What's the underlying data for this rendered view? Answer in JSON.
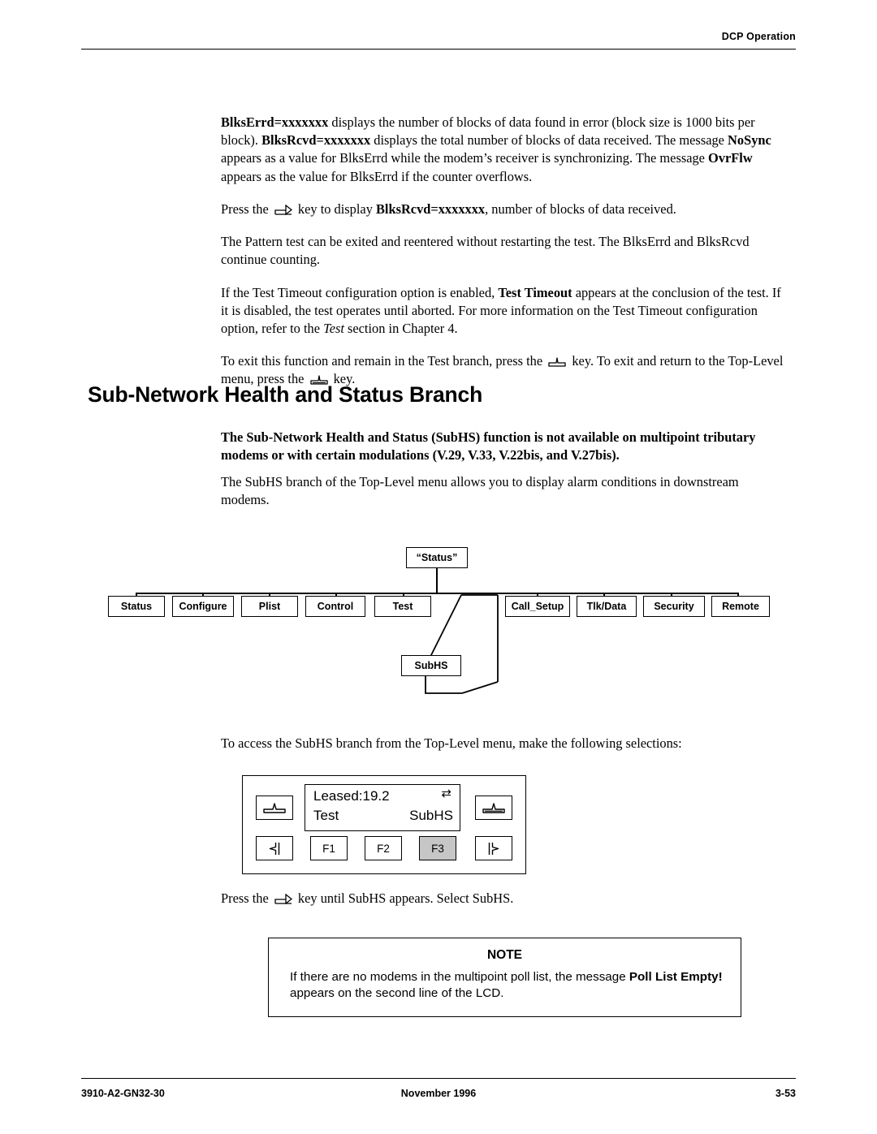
{
  "header": {
    "title": "DCP Operation"
  },
  "footer": {
    "left": "3910-A2-GN32-30",
    "center": "November 1996",
    "right": "3-53"
  },
  "paragraphs": {
    "p1_a": "BlksErrd=xxxxxxx",
    "p1_b": " displays the number of blocks of data found in error (block size is 1000 bits per block). ",
    "p1_c": "BlksRcvd=xxxxxxx",
    "p1_d": " displays the total number of blocks of data received. The message ",
    "p1_e": "NoSync",
    "p1_f": " appears as a value for BlksErrd while the modem’s receiver is synchronizing. The message ",
    "p1_g": "OvrFlw",
    "p1_h": " appears as the value for BlksErrd if the counter overflows.",
    "p2_a": "Press the ",
    "p2_b": " key to display ",
    "p2_c": "BlksRcvd=xxxxxxx",
    "p2_d": ", number of blocks of data received.",
    "p3": "The Pattern test can be exited and reentered without restarting the test. The BlksErrd and BlksRcvd continue counting.",
    "p4_a": "If the Test Timeout configuration option is enabled, ",
    "p4_b": "Test Timeout",
    "p4_c": " appears at the conclusion of the test. If it is disabled, the test operates until aborted. For more information on the Test Timeout configuration option, refer to the ",
    "p4_d": "Test",
    "p4_e": " section in Chapter 4.",
    "p5_a": "To exit this function and remain in the Test branch, press the ",
    "p5_b": " key. To exit and return to the Top-Level menu, press the ",
    "p5_c": " key.",
    "p6": "To access the SubHS branch from the Top-Level menu, make the following selections:",
    "p7_a": "Press the ",
    "p7_b": " key until SubHS appears. Select SubHS."
  },
  "section": {
    "title": "Sub-Network Health and Status Branch",
    "bold_note": "The Sub-Network Health and Status (SubHS) function is not available on multipoint tributary modems or with certain modulations (V.29, V.33, V.22bis, and V.27bis).",
    "intro": "The SubHS branch of the Top-Level menu allows you to display alarm conditions in downstream modems."
  },
  "diagram": {
    "root": "“Status”",
    "nodes": [
      "Status",
      "Configure",
      "Plist",
      "Control",
      "Test",
      "Call_Setup",
      "Tlk/Data",
      "Security",
      "Remote"
    ],
    "child": "SubHS"
  },
  "panel": {
    "lcd_line1": "Leased:19.2",
    "lcd_line2_left": "Test",
    "lcd_line2_right": "SubHS",
    "lcd_indicator": "⇄",
    "function_keys": [
      "F1",
      "F2",
      "F3"
    ],
    "selected_function_key": "F3",
    "left_arrow_key": "left-arrow-icon",
    "right_arrow_key": "right-arrow-icon",
    "up_arrow_key": "up-arrow-icon",
    "home_key": "home-arrow-icon"
  },
  "note": {
    "title": "NOTE",
    "body_a": "If there are no modems in the multipoint poll list, the message ",
    "body_b": "Poll List Empty!",
    "body_c": " appears on the second line of the LCD."
  }
}
